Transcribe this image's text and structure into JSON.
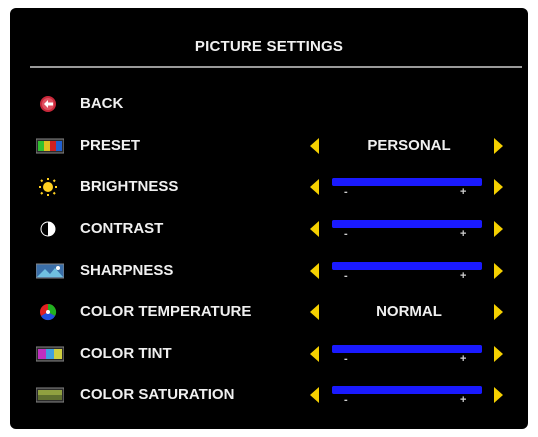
{
  "menu": {
    "title": "PICTURE SETTINGS",
    "items": [
      {
        "label": "BACK",
        "icon": "back-icon",
        "type": "action"
      },
      {
        "label": "PRESET",
        "icon": "preset-icon",
        "type": "select",
        "value": "PERSONAL"
      },
      {
        "label": "BRIGHTNESS",
        "icon": "brightness-icon",
        "type": "slider",
        "level": 1.0
      },
      {
        "label": "CONTRAST",
        "icon": "contrast-icon",
        "type": "slider",
        "level": 1.0
      },
      {
        "label": "SHARPNESS",
        "icon": "sharpness-icon",
        "type": "slider",
        "level": 1.0
      },
      {
        "label": "COLOR TEMPERATURE",
        "icon": "color-temperature-icon",
        "type": "select",
        "value": "NORMAL"
      },
      {
        "label": "COLOR TINT",
        "icon": "color-tint-icon",
        "type": "slider",
        "level": 1.0
      },
      {
        "label": "COLOR SATURATION",
        "icon": "color-saturation-icon",
        "type": "slider",
        "level": 1.0
      }
    ],
    "slider_minus": "-",
    "slider_plus": "+"
  },
  "colors": {
    "background": "#000000",
    "text": "#f0f0f0",
    "arrow": "#f5d000",
    "slider": "#1a1aff",
    "divider": "#9a9a9a"
  }
}
